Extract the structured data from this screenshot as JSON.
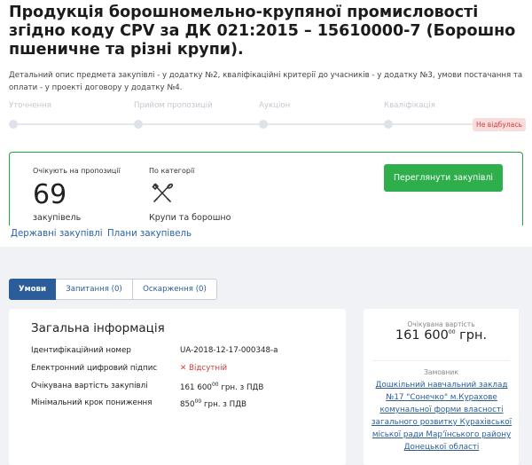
{
  "title": "Продукція борошномельно-крупяної промисловості згідно коду CPV за ДК 021:2015 – 15610000-7 (Борошно пшеничне та різні крупи).",
  "description": "Детальний опис предмета закупівлі - у додатку №2, кваліфікаційні критерії до учасників - у додатку №3, умови постачання та оплати - у проекті договору у додатку №4.",
  "stages": [
    "Уточнення",
    "Прийом пропозицій",
    "Аукціон",
    "Кваліфікація"
  ],
  "status_badge": "Не відбулась",
  "info": {
    "expected_label": "Очікують на пропозиції",
    "expected_count": "69",
    "expected_unit": "закупівель",
    "category_label": "По категорії",
    "category_icon": "utensils-icon",
    "category_text": "Крупи та борошно",
    "button": "Переглянути закупівлі"
  },
  "links": [
    "Державні закупівлі",
    "Плани закупівель"
  ],
  "tabs": [
    "Умови",
    "Запитання (0)",
    "Оскарження (0)"
  ],
  "general": {
    "title": "Загальна інформація",
    "rows": [
      {
        "label": "Ідентифікаційний номер",
        "value": "UA-2018-12-17-000348-a"
      },
      {
        "label": "Електронний цифровий підпис",
        "value": "Відсутній",
        "icon": "x-icon"
      },
      {
        "label": "Очікувана вартість закупівлі",
        "value_main": "161 600",
        "value_sup": "00",
        "value_rest": " грн. з ПДВ"
      },
      {
        "label": "Мінімальний крок пониження",
        "value_main": "850",
        "value_sup": "00",
        "value_rest": " грн. з ПДВ"
      }
    ]
  },
  "side": {
    "expected_label": "Очікувана вартість",
    "expected_main": "161 600",
    "expected_sup": "00",
    "expected_rest": " грн.",
    "customer_label": "Замовник",
    "customer_name": "Дошкільний навчальний заклад №17 \"Сонечко\" м.Курахове комунальної форми власності загального розвитку Курахівської міської ради Мар'їнського району Донецької області"
  },
  "colors": {
    "accent": "#2a5d9a",
    "green": "#2eaf4c",
    "danger": "#d23b3b"
  }
}
